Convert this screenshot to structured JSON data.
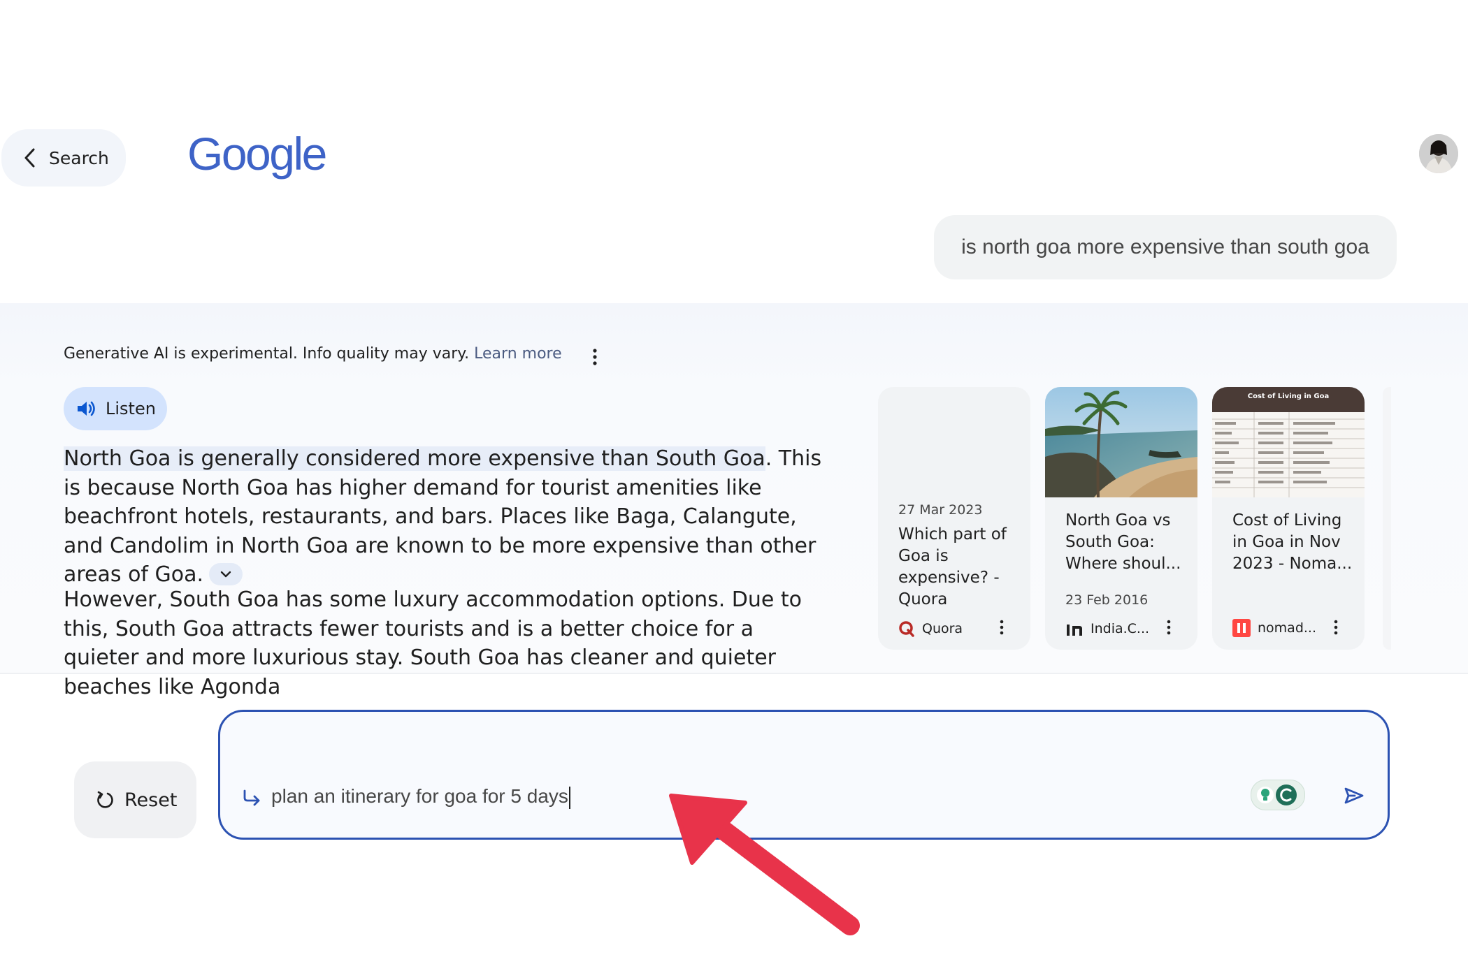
{
  "header": {
    "back_label": "Search",
    "logo_text": "Google"
  },
  "query": {
    "text": "is north goa more expensive than south goa"
  },
  "answer": {
    "disclaimer": "Generative AI is experimental. Info quality may vary.",
    "learn_more": "Learn more",
    "listen_label": "Listen",
    "para1_highlight": "North Goa is generally considered more expensive than South Goa",
    "para1_rest": ". This is because North Goa has higher demand for tourist amenities like beachfront hotels, restaurants, and bars. Places like Baga, Calangute, and Candolim in North Goa are known to be more expensive than other areas of Goa.",
    "para2": "However, South Goa has some luxury accommodation options. Due to this, South Goa attracts fewer tourists and is a better choice for a quieter and more luxurious stay. South Goa has cleaner and quieter beaches like Agonda"
  },
  "sources": [
    {
      "date": "27 Mar 2023",
      "title": "Which part of Goa is expensive? - Quora",
      "source": "Quora",
      "icon": "quora-icon"
    },
    {
      "date": "23 Feb 2016",
      "title": "North Goa vs South Goa: Where shoul...",
      "source": "India.C...",
      "icon": "india-icon"
    },
    {
      "date": "",
      "title": "Cost of Living in Goa in Nov 2023 - Noma...",
      "source": "nomad...",
      "icon": "nomad-icon",
      "thumb_heading": "Cost of Living in Goa"
    }
  ],
  "followup": {
    "reset_label": "Reset",
    "input_text": "plan an itinerary for goa for 5 days"
  },
  "colors": {
    "accent": "#2c52b2",
    "logo": "#3e63c7",
    "listen_bg": "#d3e3fd",
    "annotation_arrow": "#e8334a"
  }
}
